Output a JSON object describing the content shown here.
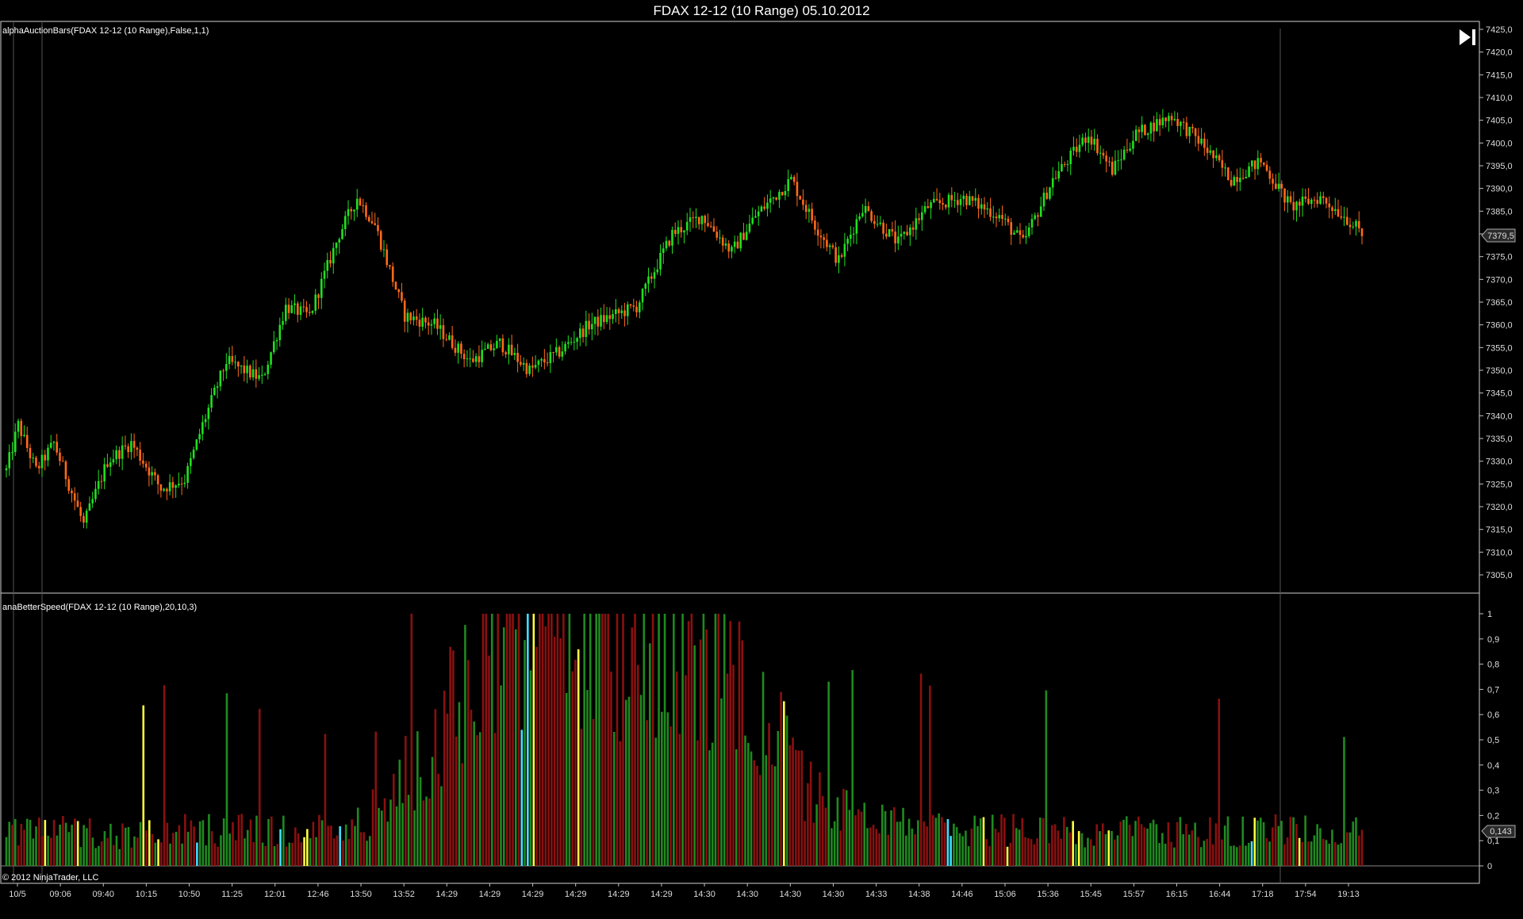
{
  "window": {
    "title": "FDAX 12-12 (10 Range)  05.10.2012"
  },
  "copyright": "© 2012 NinjaTrader, LLC",
  "colors": {
    "background": "#000000",
    "up_bar": "#20e020",
    "down_bar": "#ff6a1a",
    "speed_up": "#1f8a1f",
    "speed_down": "#8b1010",
    "speed_yellow": "#ffff40",
    "speed_cyan": "#40e0ff",
    "speed_white": "#ffffff",
    "axis": "#c0c0c0"
  },
  "icons": {
    "goto_end": "skip-forward-icon",
    "price_marker": "price-tag-icon"
  },
  "chart_data": [
    {
      "type": "candlestick",
      "title": "alphaAuctionBars(FDAX 12-12 (10 Range),False,1,1)",
      "ylim": [
        7301,
        7426
      ],
      "y_ticks": [
        "7425,0",
        "7420,0",
        "7415,0",
        "7410,0",
        "7405,0",
        "7400,0",
        "7395,0",
        "7390,0",
        "7385,0",
        "7380,0",
        "7375,0",
        "7370,0",
        "7365,0",
        "7360,0",
        "7355,0",
        "7350,0",
        "7345,0",
        "7340,0",
        "7335,0",
        "7330,0",
        "7325,0",
        "7320,0",
        "7315,0",
        "7310,0",
        "7305,0"
      ],
      "last_price_label": "7379,5",
      "last_price": 7379.5,
      "path_waypoints": [
        [
          0,
          7328
        ],
        [
          4,
          7338
        ],
        [
          10,
          7328
        ],
        [
          16,
          7334
        ],
        [
          26,
          7316
        ],
        [
          34,
          7330
        ],
        [
          42,
          7334
        ],
        [
          52,
          7324
        ],
        [
          60,
          7326
        ],
        [
          66,
          7338
        ],
        [
          74,
          7352
        ],
        [
          86,
          7348
        ],
        [
          94,
          7364
        ],
        [
          102,
          7362
        ],
        [
          112,
          7380
        ],
        [
          118,
          7388
        ],
        [
          124,
          7382
        ],
        [
          134,
          7362
        ],
        [
          144,
          7360
        ],
        [
          156,
          7352
        ],
        [
          166,
          7356
        ],
        [
          176,
          7350
        ],
        [
          186,
          7354
        ],
        [
          196,
          7360
        ],
        [
          212,
          7364
        ],
        [
          224,
          7380
        ],
        [
          234,
          7384
        ],
        [
          244,
          7376
        ],
        [
          252,
          7384
        ],
        [
          258,
          7388
        ],
        [
          264,
          7392
        ],
        [
          272,
          7382
        ],
        [
          280,
          7374
        ],
        [
          288,
          7386
        ],
        [
          300,
          7378
        ],
        [
          310,
          7386
        ],
        [
          322,
          7388
        ],
        [
          334,
          7384
        ],
        [
          342,
          7378
        ],
        [
          352,
          7392
        ],
        [
          364,
          7402
        ],
        [
          372,
          7394
        ],
        [
          380,
          7402
        ],
        [
          392,
          7406
        ],
        [
          402,
          7400
        ],
        [
          412,
          7392
        ],
        [
          422,
          7396
        ],
        [
          432,
          7386
        ],
        [
          442,
          7388
        ],
        [
          450,
          7384
        ],
        [
          456,
          7380
        ]
      ],
      "x_ticks": [
        "10/5",
        "09:06",
        "09:40",
        "10:15",
        "10:50",
        "11:25",
        "12:01",
        "12:46",
        "13:50",
        "13:52",
        "14:29",
        "14:29",
        "14:29",
        "14:29",
        "14:29",
        "14:29",
        "14:30",
        "14:30",
        "14:30",
        "14:30",
        "14:33",
        "14:38",
        "14:46",
        "15:06",
        "15:36",
        "15:45",
        "15:57",
        "16:15",
        "16:44",
        "17:18",
        "17:54",
        "19:13"
      ]
    },
    {
      "type": "bar",
      "title": "anaBetterSpeed(FDAX 12-12 (10 Range),20,10,3)",
      "ylim": [
        0,
        1
      ],
      "y_ticks": [
        "1",
        "0,9",
        "0,8",
        "0,7",
        "0,6",
        "0,5",
        "0,4",
        "0,3",
        "0,2",
        "0,1",
        "0"
      ],
      "last_value_label": "0,143",
      "last_value": 0.143,
      "value_waypoints": [
        [
          0,
          0.16
        ],
        [
          20,
          0.15
        ],
        [
          40,
          0.13
        ],
        [
          60,
          0.15
        ],
        [
          80,
          0.15
        ],
        [
          100,
          0.14
        ],
        [
          120,
          0.18
        ],
        [
          140,
          0.45
        ],
        [
          150,
          0.75
        ],
        [
          160,
          0.9
        ],
        [
          190,
          0.98
        ],
        [
          220,
          0.95
        ],
        [
          240,
          0.9
        ],
        [
          255,
          0.6
        ],
        [
          270,
          0.3
        ],
        [
          290,
          0.18
        ],
        [
          320,
          0.15
        ],
        [
          350,
          0.15
        ],
        [
          380,
          0.14
        ],
        [
          420,
          0.15
        ],
        [
          456,
          0.14
        ]
      ],
      "color_legend": [
        "speed_up",
        "speed_down",
        "speed_yellow",
        "speed_cyan",
        "speed_white"
      ]
    }
  ]
}
